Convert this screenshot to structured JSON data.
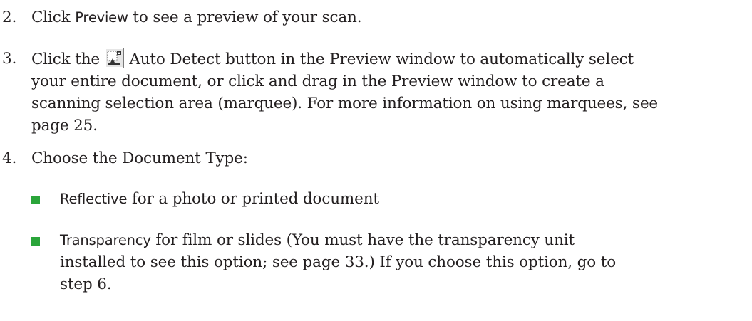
{
  "steps": [
    {
      "number": "2.",
      "pre": "Click ",
      "ui_term": "Preview",
      "post": " to see a preview of your scan."
    },
    {
      "number": "3.",
      "pre": "Click the ",
      "icon": "auto-detect-icon",
      "line1_rest": " Auto Detect button in the Preview window to automatically select",
      "line2": "your entire document, or click and drag in the Preview window to create a",
      "line3": "scanning selection area (marquee). For more information on using marquees, see",
      "line4": "page 25."
    },
    {
      "number": "4.",
      "text": "Choose the Document Type:"
    }
  ],
  "options": [
    {
      "ui_term": "Reflective",
      "rest": " for a photo or printed document"
    },
    {
      "ui_term": "Transparency",
      "line1_rest": " for film or slides (You must have the transparency unit",
      "line2": "installed to see this option; see page 33.) If you choose this option, go to",
      "line3": "step 6."
    }
  ],
  "colors": {
    "bullet": "#2aa53a",
    "text": "#231f20"
  }
}
